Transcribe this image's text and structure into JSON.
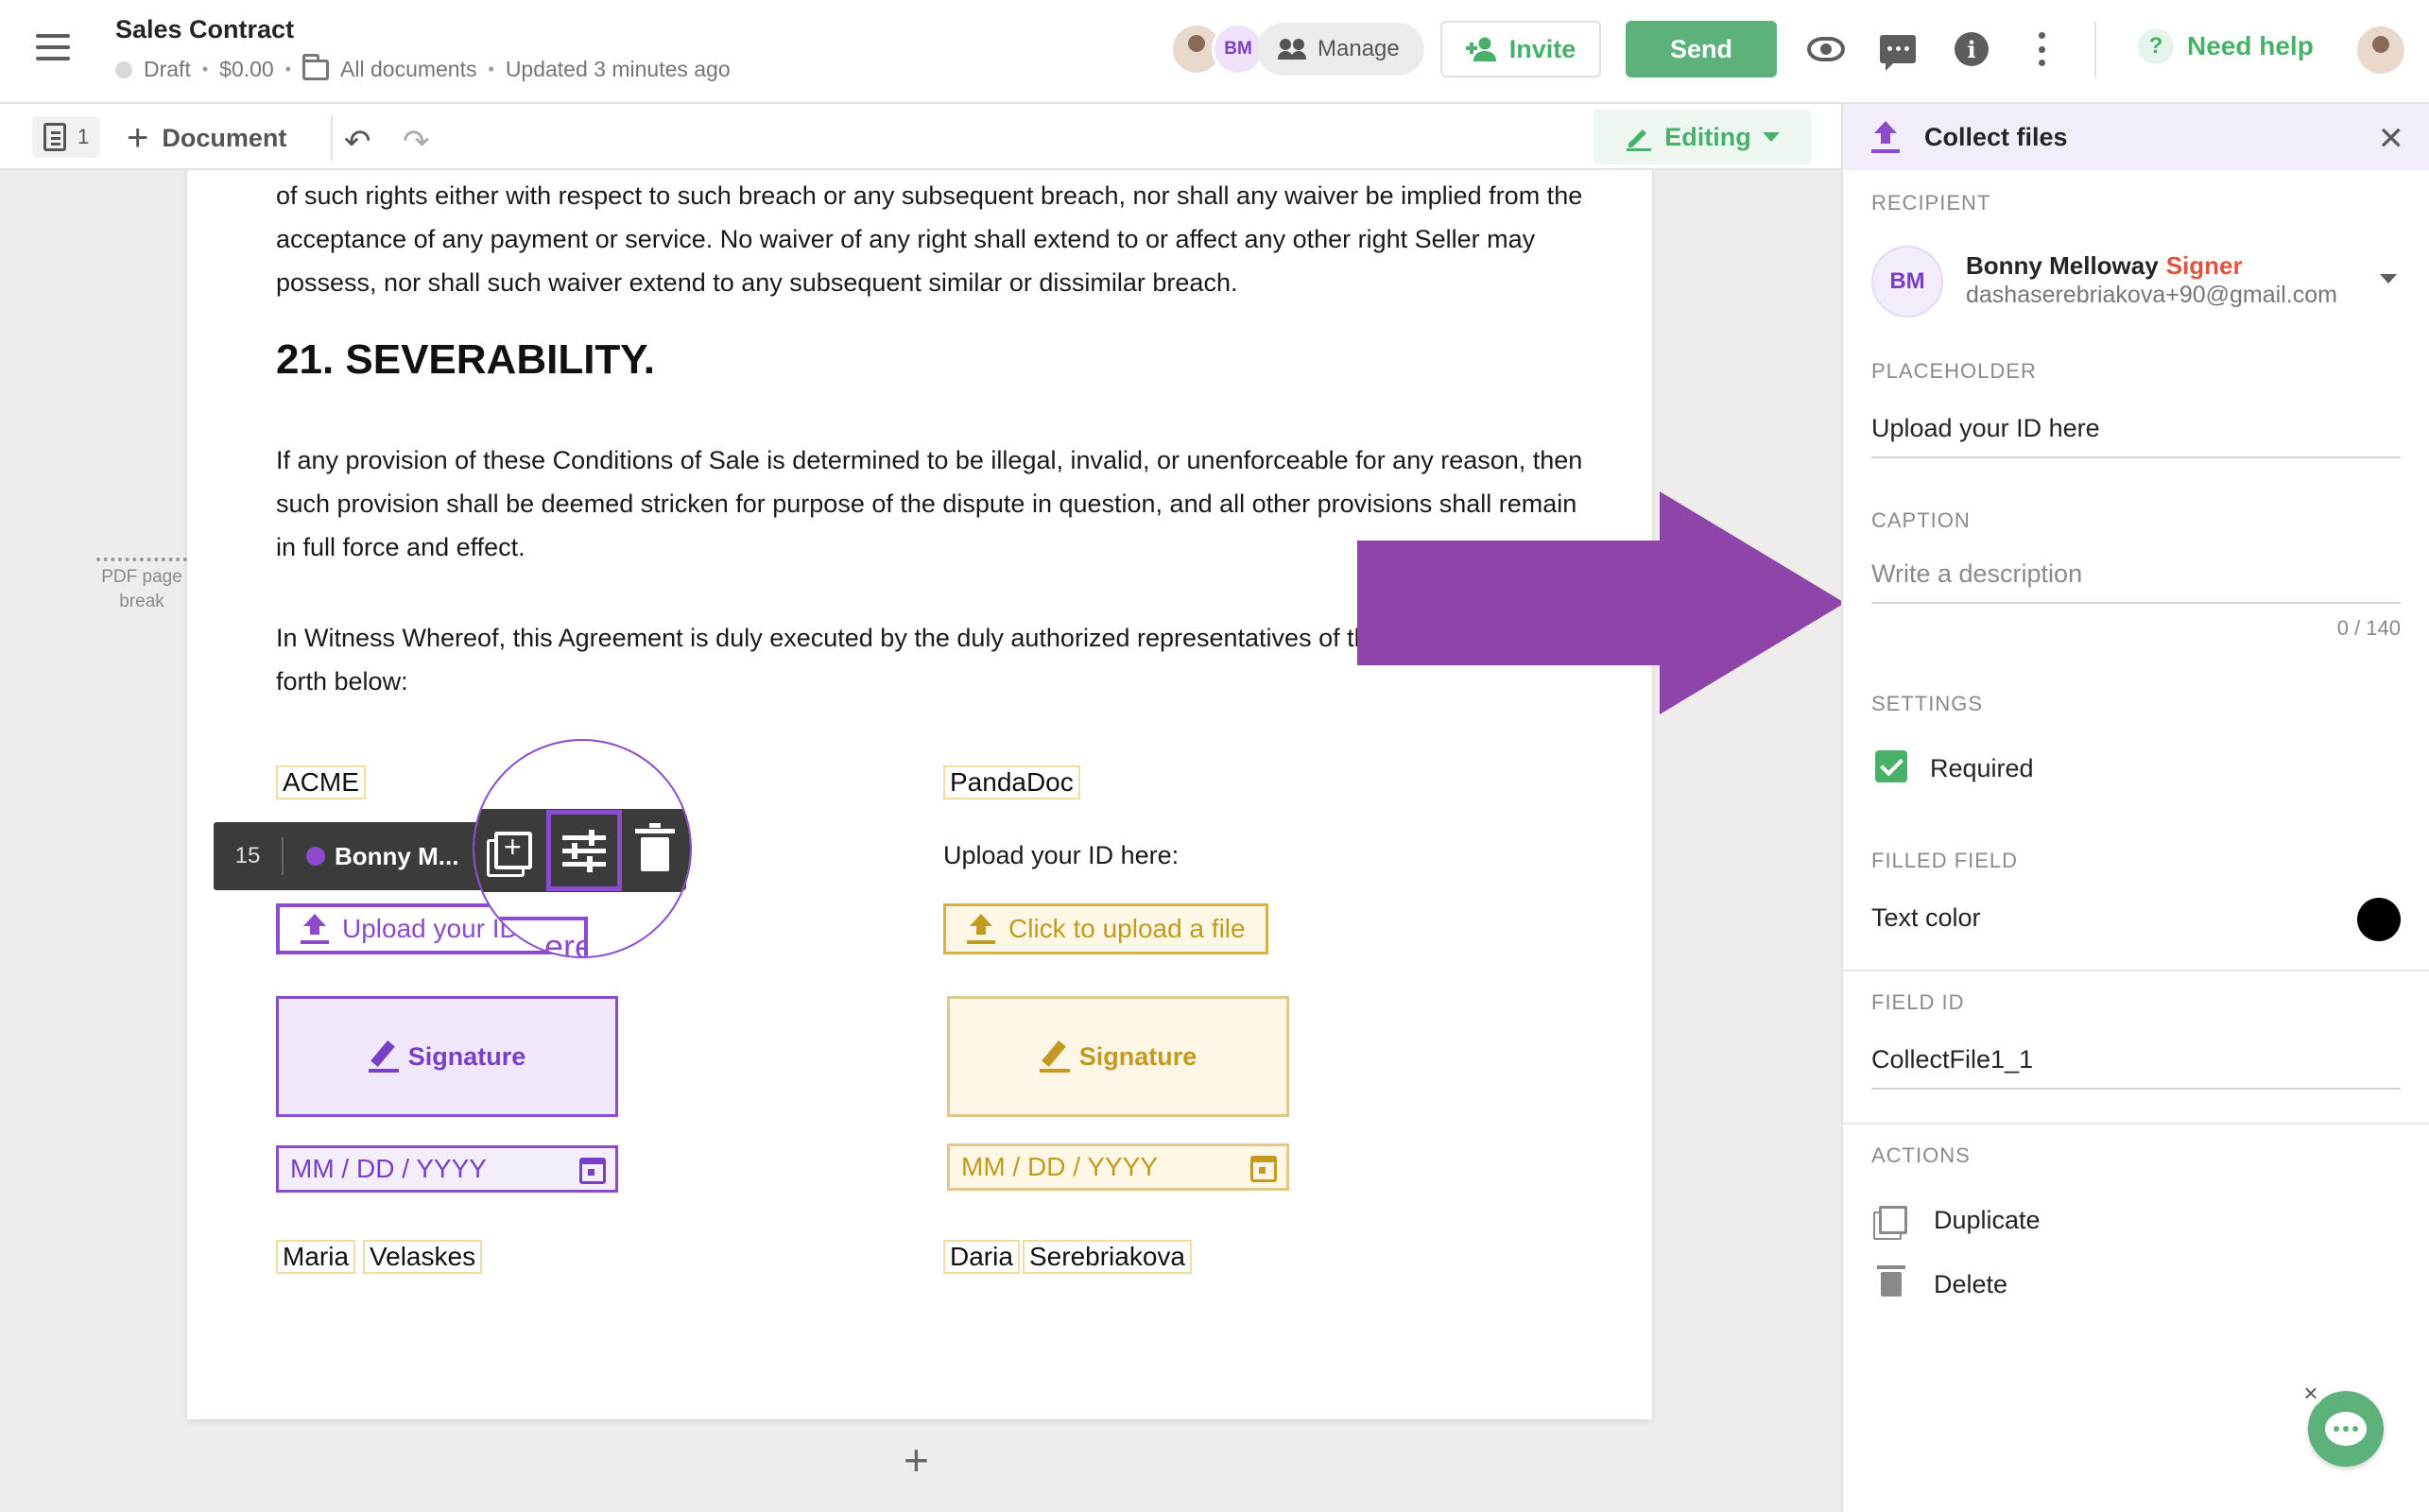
{
  "header": {
    "title": "Sales Contract",
    "status": "Draft",
    "amount": "$0.00",
    "folder": "All documents",
    "updated": "Updated 3 minutes ago",
    "avatar_initials": "BM",
    "manage_label": "Manage",
    "invite_label": "Invite",
    "send_label": "Send",
    "help_label": "Need help",
    "info_glyph": "i",
    "help_glyph": "?"
  },
  "toolbar": {
    "page_count": "1",
    "add_document_label": "Document",
    "editing_label": "Editing",
    "undo_glyph": "↶",
    "redo_glyph": "↷"
  },
  "document": {
    "para_top": "of such rights either with respect to such breach or any subsequent breach, nor shall any waiver be implied from the acceptance of any payment or service. No waiver of any right shall extend to or affect any other right Seller may possess, nor shall such waiver extend to any subsequent similar or dissimilar breach.",
    "heading": "21. SEVERABILITY.",
    "para_severability": "If any provision of these Conditions of Sale is determined to be illegal, invalid, or unenforceable for any reason, then such provision shall be deemed stricken for purpose of the dispute in question, and all other provisions shall remain in full force and effect.",
    "para_witness": "In Witness Whereof, this Agreement is duly executed by the duly authorized representatives of the parties as set forth below:",
    "party_left": "ACME",
    "party_right": "PandaDoc",
    "upload_prompt": "Upload your ID here:",
    "left_upload_label": "Upload your ID here",
    "right_upload_label": "Click to upload a file",
    "signature_label": "Signature",
    "date_placeholder": "MM / DD / YYYY",
    "left_first": "Maria",
    "left_last": "Velaskes",
    "right_first": "Daria",
    "right_last": "Serebriakova",
    "pagebreak_label": "PDF page break",
    "add_page_glyph": "+"
  },
  "field_toolbar": {
    "number": "15",
    "signer": "Bonny M...",
    "magnified_text": "ere"
  },
  "panel": {
    "title": "Collect files",
    "close_glyph": "✕",
    "recipient_label": "RECIPIENT",
    "recipient_initials": "BM",
    "recipient_name": "Bonny Melloway",
    "recipient_role": "Signer",
    "recipient_email": "dashaserebriakova+90@gmail.com",
    "placeholder_label": "PLACEHOLDER",
    "placeholder_value": "Upload your ID here",
    "caption_label": "CAPTION",
    "caption_placeholder": "Write a description",
    "caption_counter": "0 / 140",
    "settings_label": "SETTINGS",
    "required_label": "Required",
    "filled_field_label": "FILLED FIELD",
    "text_color_label": "Text color",
    "text_color": "#000000",
    "field_id_label": "FIELD ID",
    "field_id_value": "CollectFile1_1",
    "actions_label": "ACTIONS",
    "duplicate_label": "Duplicate",
    "delete_label": "Delete"
  },
  "colors": {
    "accent_green": "#47b16a",
    "send_green": "#5cb27a",
    "signer_purple": "#8c4bcf",
    "annotation_purple": "#8e44a8",
    "signer2_gold": "#d8b13f",
    "role_red": "#e0533d"
  },
  "icons": [
    "menu-icon",
    "folder-icon",
    "people-icon",
    "add-person-icon",
    "eye-icon",
    "comment-icon",
    "info-icon",
    "more-icon",
    "help-icon",
    "pages-icon",
    "undo-icon",
    "redo-icon",
    "pencil-icon",
    "upload-icon",
    "signature-pen-icon",
    "calendar-icon",
    "duplicate-icon",
    "settings-sliders-icon",
    "trash-icon",
    "close-icon",
    "check-icon",
    "chat-icon"
  ]
}
